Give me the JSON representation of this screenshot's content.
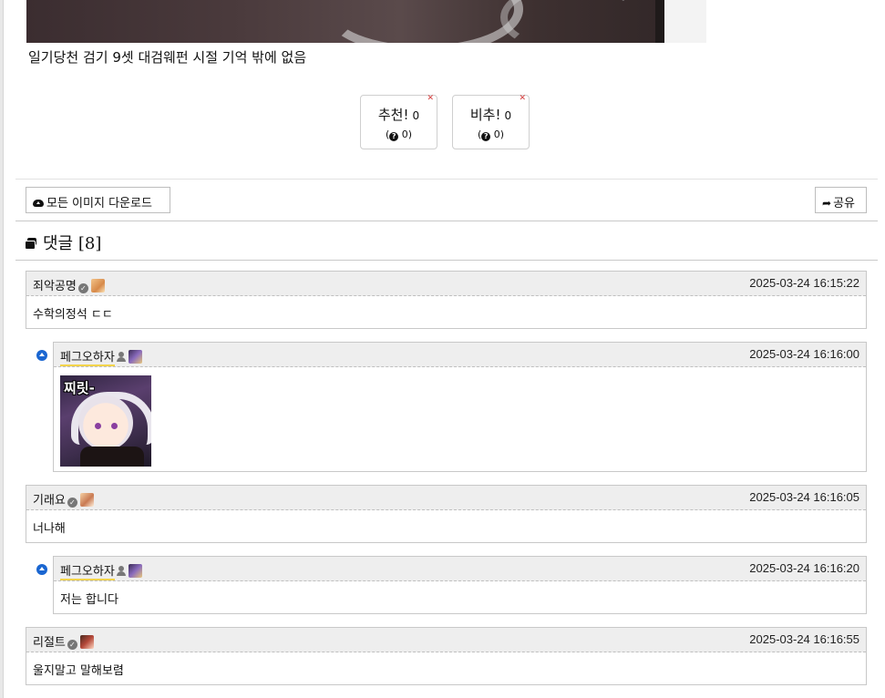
{
  "post": {
    "caption": "일기당천 검기 9셋 대검웨펀 시절 기억 밖에 없음"
  },
  "votes": {
    "up": {
      "label": "추천!",
      "count": "0",
      "sub_count": "0"
    },
    "down": {
      "label": "비추!",
      "count": "0",
      "sub_count": "0"
    }
  },
  "toolbar": {
    "download_label": "모든 이미지 다운로드",
    "share_label": "공유"
  },
  "comments_section": {
    "title": "댓글",
    "count": "[8]"
  },
  "comments": [
    {
      "author": "죄악공명",
      "date": "2025-03-24 16:15:22",
      "text": "수학의정석 ㄷㄷ",
      "avatar_icon": "user-avatar-icon"
    },
    {
      "author": "페그오하자",
      "date": "2025-03-24 16:16:00",
      "sticker_text": "찌릿-",
      "avatar_icon": "user-avatar-icon"
    },
    {
      "author": "기래요",
      "date": "2025-03-24 16:16:05",
      "text": "너나해",
      "avatar_icon": "user-avatar-icon"
    },
    {
      "author": "페그오하자",
      "date": "2025-03-24 16:16:20",
      "text": "저는 합니다",
      "avatar_icon": "user-avatar-icon"
    },
    {
      "author": "리절트",
      "date": "2025-03-24 16:16:55",
      "text": "울지말고 말해보렴",
      "avatar_icon": "user-avatar-icon"
    }
  ],
  "colors": {
    "reply_arrow": "#1a66d1",
    "header_bg": "#eeeeee",
    "nick_highlight": "#f2d34b"
  }
}
